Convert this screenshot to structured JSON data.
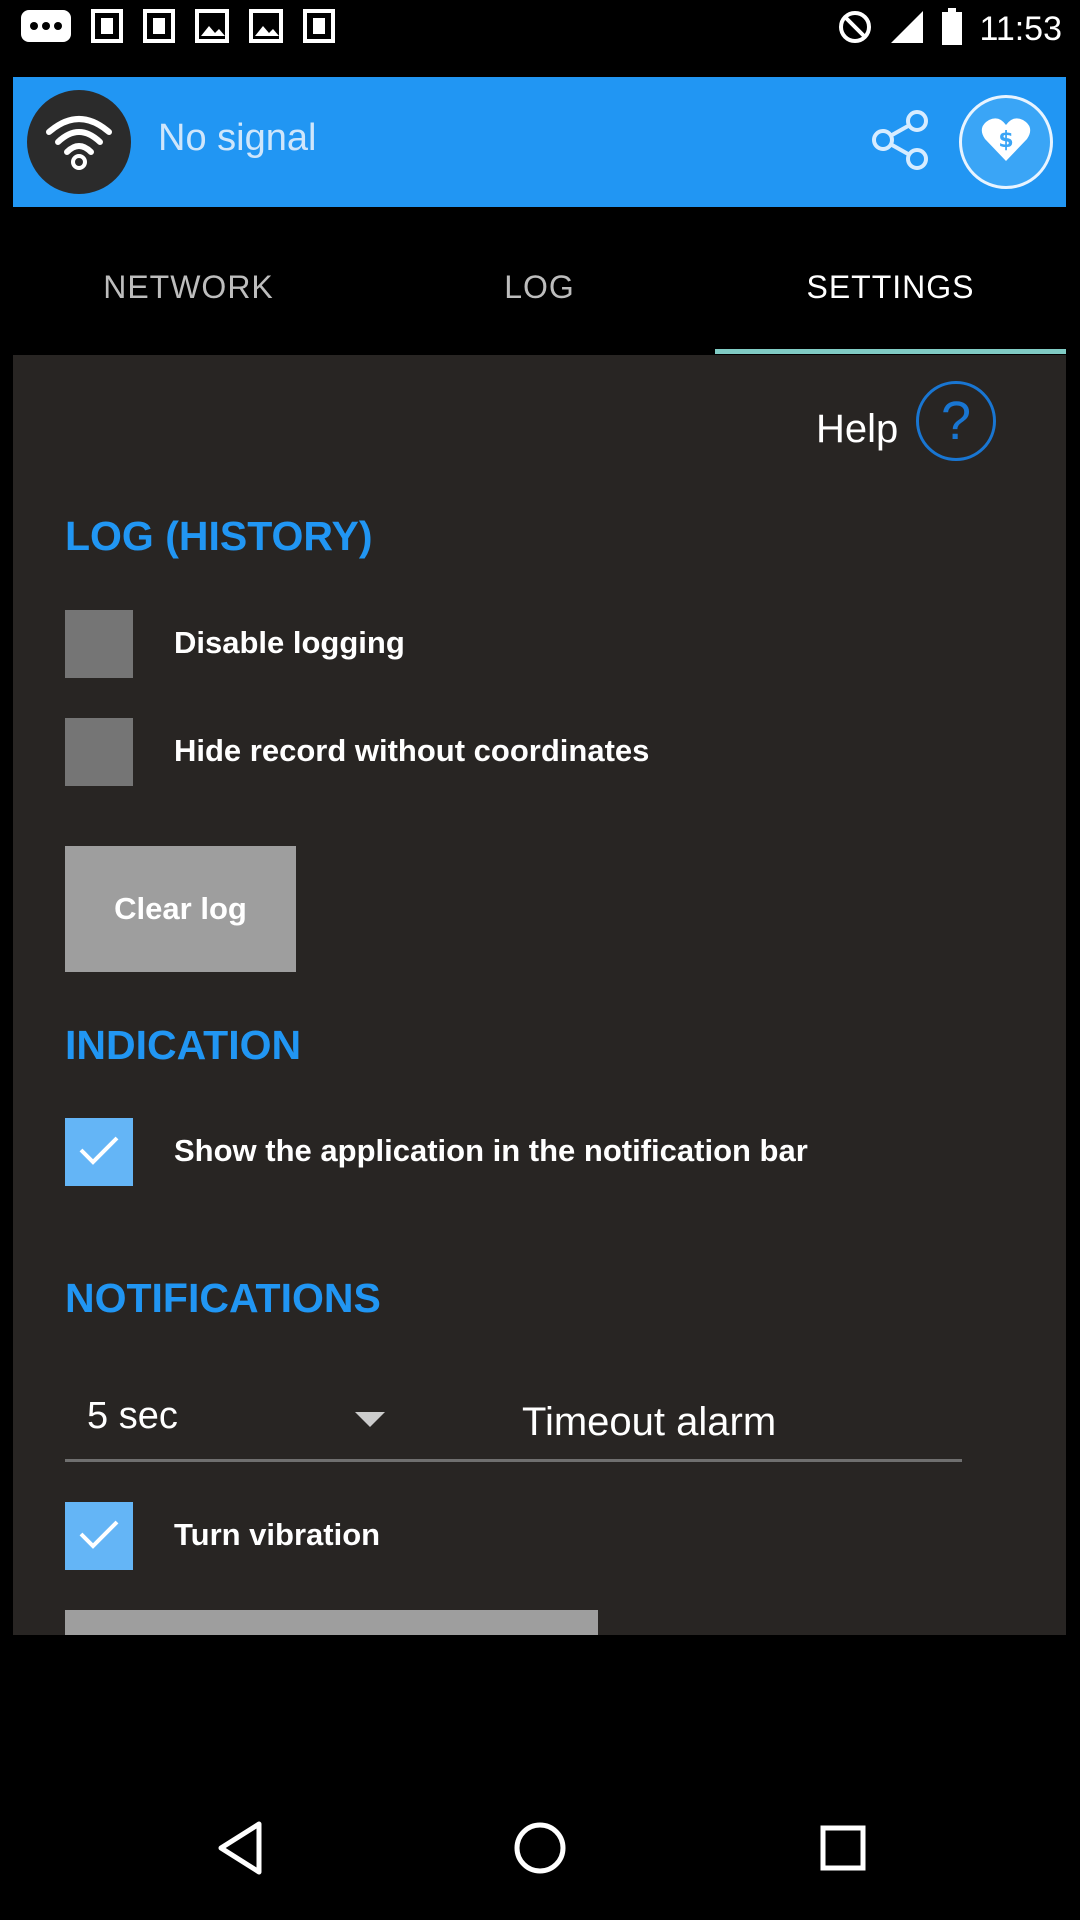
{
  "status_bar": {
    "time": "11:53",
    "left_icons": [
      "more-icon",
      "dual-sim-icon",
      "dual-sim-icon",
      "image-icon",
      "image-icon",
      "dual-sim-icon"
    ],
    "right_icons": [
      "block-icon",
      "signal-icon",
      "battery-icon"
    ]
  },
  "header": {
    "signal_text": "No signal",
    "accent_color": "#2196f3"
  },
  "tabs": [
    {
      "label": "NETWORK",
      "active": false
    },
    {
      "label": "LOG",
      "active": false
    },
    {
      "label": "SETTINGS",
      "active": true
    }
  ],
  "settings": {
    "help_label": "Help",
    "help_icon_glyph": "?",
    "log_section_title": "LOG (HISTORY)",
    "disable_logging_label": "Disable logging",
    "disable_logging_checked": false,
    "hide_record_label": "Hide record without coordinates",
    "hide_record_checked": false,
    "clear_log_button": "Clear log",
    "indication_section_title": "INDICATION",
    "show_notification_label": "Show the application in the notification bar",
    "show_notification_checked": true,
    "notifications_section_title": "NOTIFICATIONS",
    "timeout_value": "5 sec",
    "timeout_label": "Timeout alarm",
    "vibration_label": "Turn vibration",
    "vibration_checked": true
  },
  "nav": [
    "back-icon",
    "home-icon",
    "recents-icon"
  ]
}
